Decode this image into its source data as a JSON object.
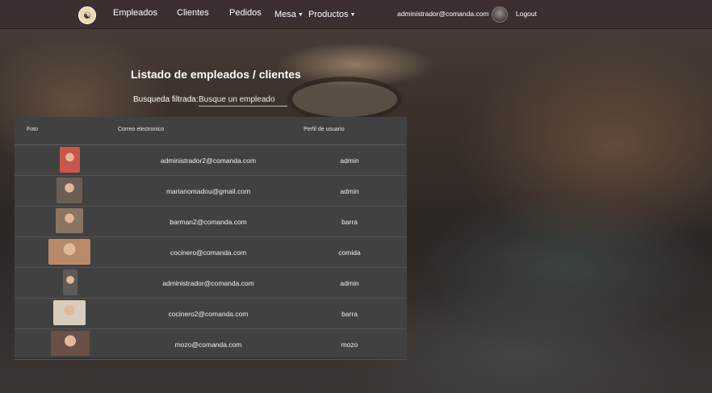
{
  "nav": {
    "items": [
      "Empleados",
      "Clientes",
      "Pedidos"
    ],
    "dropdowns": [
      "Mesa",
      "Productos"
    ],
    "email": "administrador@comanda.com",
    "logout": "Logout",
    "brand_icon": "utensils-icon"
  },
  "page": {
    "title": "Listado de empleados / clientes",
    "search_label": "Busqueda filtrada:",
    "search_placeholder": "Busque un empleado",
    "search_value": ""
  },
  "table": {
    "headers": [
      "Foto",
      "Correo electronico",
      "Perfil de usuario"
    ],
    "rows": [
      {
        "email": "administrador2@comanda.com",
        "perfil": "admin",
        "photo_color": "#c9564a"
      },
      {
        "email": "marianomadou@gmail.com",
        "perfil": "admin",
        "photo_color": "#6b5e56"
      },
      {
        "email": "barman2@comanda.com",
        "perfil": "barra",
        "photo_color": "#8a7562"
      },
      {
        "email": "cocinero@comanda.com",
        "perfil": "comida",
        "photo_color": "#b88a6a"
      },
      {
        "email": "administrador@comanda.com",
        "perfil": "admin",
        "photo_color": "#5d5a58"
      },
      {
        "email": "cocinero2@comanda.com",
        "perfil": "barra",
        "photo_color": "#d9cdbf"
      },
      {
        "email": "mozo@comanda.com",
        "perfil": "mozo",
        "photo_color": "#6a5048"
      }
    ]
  }
}
